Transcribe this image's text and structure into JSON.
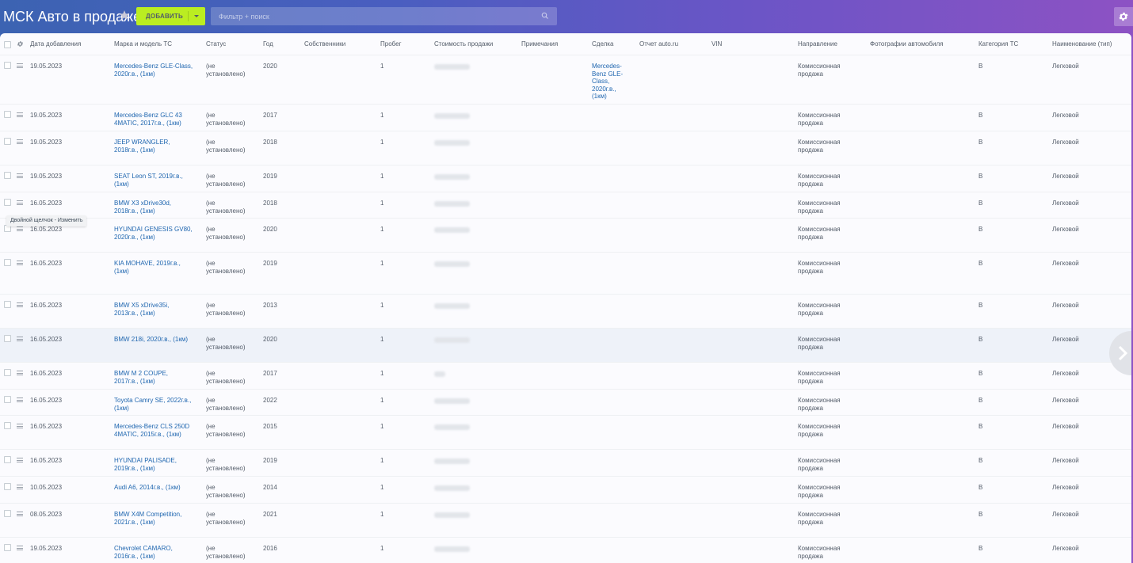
{
  "header": {
    "title": "МСК Авто в продаже",
    "add_label": "ДОБАВИТЬ",
    "search_placeholder": "Фильтр + поиск"
  },
  "columns": {
    "date": "Дата добавления",
    "model": "Марка и модель ТС",
    "status": "Статус",
    "year": "Год",
    "owners": "Собственники",
    "mileage": "Пробег",
    "price": "Стоимость продажи",
    "notes": "Примечания",
    "deal": "Сделка",
    "report": "Отчет auto.ru",
    "vin": "VIN",
    "direction": "Направление",
    "photos": "Фотографии автомобиля",
    "category": "Категория ТС",
    "type": "Наименование (тип)"
  },
  "tooltip": "Двойной щелчок - Изменить",
  "rows": [
    {
      "date": "19.05.2023",
      "model": "Mercedes-Benz GLE-Class, 2020г.в., (1км)",
      "status": "(не установлено)",
      "year": "2020",
      "mileage": "1",
      "deal": "Mercedes-Benz GLE-Class, 2020г.в., (1км)",
      "direction": "Комиссионная продажа",
      "category": "B",
      "type": "Легковой"
    },
    {
      "date": "19.05.2023",
      "model": "Mercedes-Benz GLC 43 4MATIC, 2017г.в., (1км)",
      "status": "(не установлено)",
      "year": "2017",
      "mileage": "1",
      "deal": "",
      "direction": "Комиссионная продажа",
      "category": "B",
      "type": "Легковой"
    },
    {
      "date": "19.05.2023",
      "model": "JEEP WRANGLER, 2018г.в., (1км)",
      "status": "(не установлено)",
      "year": "2018",
      "mileage": "1",
      "deal": "",
      "direction": "Комиссионная продажа",
      "category": "B",
      "type": "Легковой"
    },
    {
      "date": "19.05.2023",
      "model": "SEAT Leon ST, 2019г.в., (1км)",
      "status": "(не установлено)",
      "year": "2019",
      "mileage": "1",
      "deal": "",
      "direction": "Комиссионная продажа",
      "category": "B",
      "type": "Легковой"
    },
    {
      "date": "16.05.2023",
      "model": "BMW X3 xDrive30d, 2018г.в., (1км)",
      "status": "(не установлено)",
      "year": "2018",
      "mileage": "1",
      "deal": "",
      "direction": "Комиссионная продажа",
      "category": "B",
      "type": "Легковой"
    },
    {
      "date": "16.05.2023",
      "model": "HYUNDAI GENESIS GV80, 2020г.в., (1км)",
      "status": "(не установлено)",
      "year": "2020",
      "mileage": "1",
      "deal": "",
      "direction": "Комиссионная продажа",
      "category": "B",
      "type": "Легковой"
    },
    {
      "date": "16.05.2023",
      "model": "KIA MOHAVE, 2019г.в., (1км)",
      "status": "(не установлено)",
      "year": "2019",
      "mileage": "1",
      "deal": "",
      "direction": "Комиссионная продажа",
      "category": "B",
      "type": "Легковой"
    },
    {
      "date": "16.05.2023",
      "model": "BMW X5 xDrive35i, 2013г.в., (1км)",
      "status": "(не установлено)",
      "year": "2013",
      "mileage": "1",
      "deal": "",
      "direction": "Комиссионная продажа",
      "category": "B",
      "type": "Легковой"
    },
    {
      "date": "16.05.2023",
      "model": "BMW 218i, 2020г.в., (1км)",
      "status": "(не установлено)",
      "year": "2020",
      "mileage": "1",
      "deal": "",
      "direction": "Комиссионная продажа",
      "category": "B",
      "type": "Легковой"
    },
    {
      "date": "16.05.2023",
      "model": "BMW M 2 COUPE, 2017г.в., (1км)",
      "status": "(не установлено)",
      "year": "2017",
      "mileage": "1",
      "deal": "",
      "direction": "Комиссионная продажа",
      "category": "B",
      "type": "Легковой"
    },
    {
      "date": "16.05.2023",
      "model": "Toyota Camry SE, 2022г.в., (1км)",
      "status": "(не установлено)",
      "year": "2022",
      "mileage": "1",
      "deal": "",
      "direction": "Комиссионная продажа",
      "category": "B",
      "type": "Легковой"
    },
    {
      "date": "16.05.2023",
      "model": "Mercedes-Benz CLS 250D 4MATIC, 2015г.в., (1км)",
      "status": "(не установлено)",
      "year": "2015",
      "mileage": "1",
      "deal": "",
      "direction": "Комиссионная продажа",
      "category": "B",
      "type": "Легковой"
    },
    {
      "date": "16.05.2023",
      "model": "HYUNDAI PALISADE, 2019г.в., (1км)",
      "status": "(не установлено)",
      "year": "2019",
      "mileage": "1",
      "deal": "",
      "direction": "Комиссионная продажа",
      "category": "B",
      "type": "Легковой"
    },
    {
      "date": "10.05.2023",
      "model": "Audi A6, 2014г.в., (1км)",
      "status": "(не установлено)",
      "year": "2014",
      "mileage": "1",
      "deal": "",
      "direction": "Комиссионная продажа",
      "category": "B",
      "type": "Легковой"
    },
    {
      "date": "08.05.2023",
      "model": "BMW X4M Competition, 2021г.в., (1км)",
      "status": "(не установлено)",
      "year": "2021",
      "mileage": "1",
      "deal": "",
      "direction": "Комиссионная продажа",
      "category": "B",
      "type": "Легковой"
    },
    {
      "date": "19.05.2023",
      "model": "Chevrolet CAMARO, 2016г.в., (1км)",
      "status": "(не установлено)",
      "year": "2016",
      "mileage": "1",
      "deal": "",
      "direction": "Комиссионная продажа",
      "category": "B",
      "type": "Легковой"
    }
  ]
}
